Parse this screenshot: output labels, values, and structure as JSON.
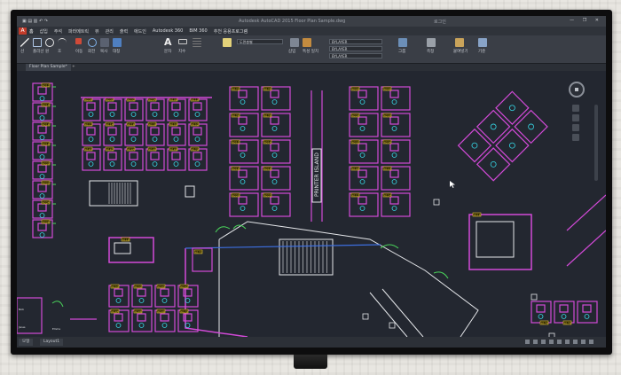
{
  "app": {
    "title_center": "Autodesk AutoCAD 2015   Floor Plan Sample.dwg",
    "account": "로그인",
    "window_buttons": "— ❐ ✕",
    "logo": "A"
  },
  "menu_tabs": [
    "홈",
    "삽입",
    "주석",
    "파라메트릭",
    "뷰",
    "관리",
    "출력",
    "애드인",
    "Autodesk 360",
    "BIM 360",
    "추천 응용프로그램"
  ],
  "ribbon": {
    "panels": [
      "그리기",
      "수정",
      "주석",
      "도면층",
      "블록",
      "특성",
      "그룹",
      "유틸리티",
      "클립보드",
      "뷰"
    ],
    "tool_labels": [
      "선",
      "폴리선",
      "원",
      "호",
      "이동",
      "회전",
      "복사",
      "대칭",
      "문자",
      "치수",
      "삽입",
      "특성 일치",
      "그룹",
      "측정",
      "붙여넣기",
      "기준"
    ],
    "layer_combo": "도면층별",
    "color_combo": "BYLAYER"
  },
  "document": {
    "tab": "Floor Plan Sample*",
    "new_tab_symbol": "+"
  },
  "drawing": {
    "printer_label": "PRINTER ISLAND",
    "room_tags": [
      "6212",
      "6214",
      "6216",
      "6218",
      "6220",
      "6222",
      "6224",
      "6226",
      "6228",
      "6230",
      "6232",
      "6234",
      "6108",
      "6110",
      "6112",
      "6114",
      "6116",
      "6118",
      "6150",
      "6152",
      "6160",
      "6162",
      "6164",
      "6166",
      "6168",
      "6170",
      "6172",
      "6174",
      "6176",
      "6178"
    ]
  },
  "statusbar": {
    "model_tab": "모형",
    "layout_tab": "Layout1"
  },
  "colors": {
    "magenta": "#d34ad8",
    "cyan": "#36d8e6",
    "green": "#49d35a",
    "yellow": "#e6c63a",
    "white": "#e5e7ea",
    "blue": "#3d6fe0"
  }
}
